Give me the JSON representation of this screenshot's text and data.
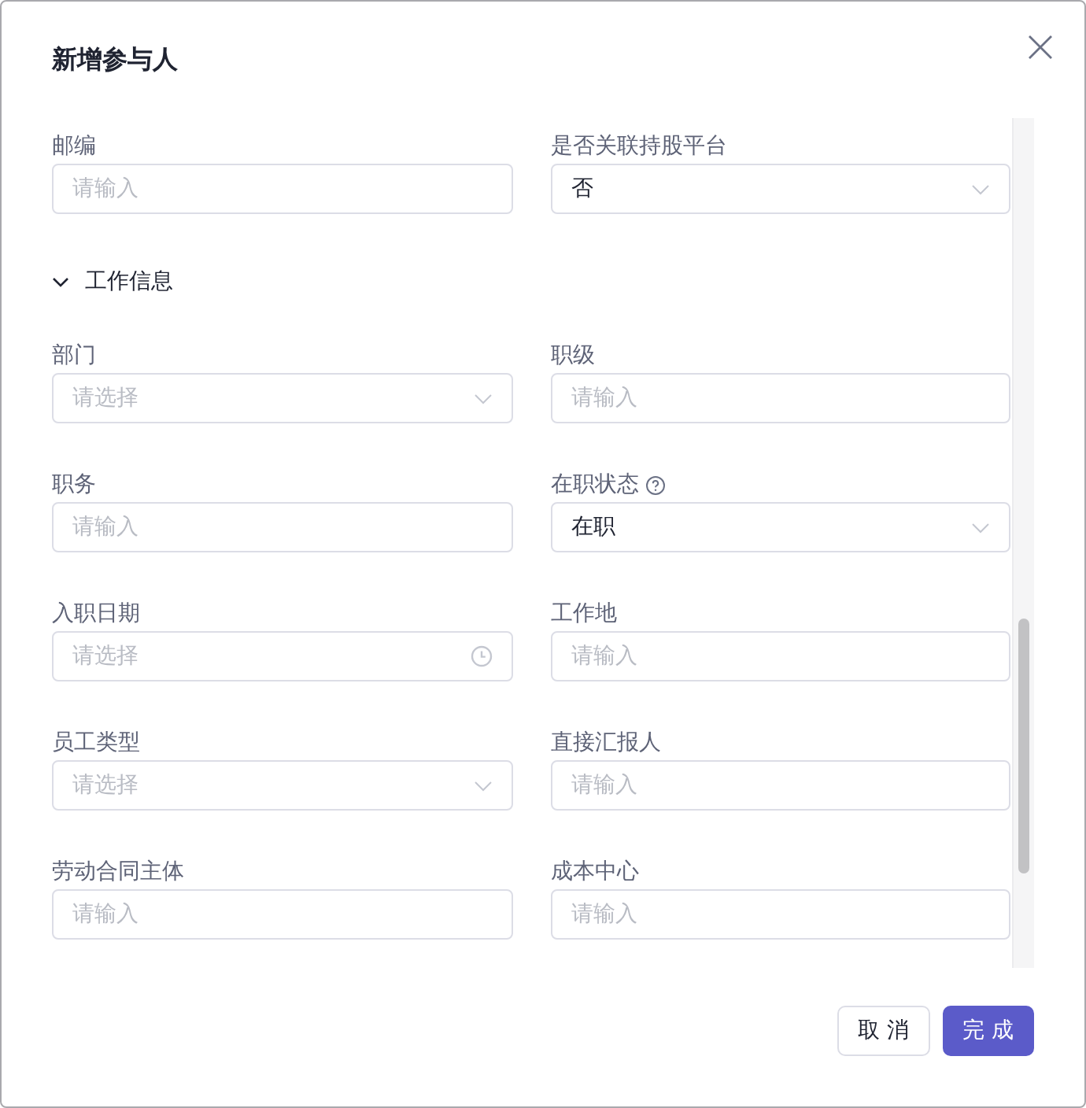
{
  "dialog": {
    "title": "新增参与人"
  },
  "sections": [
    {
      "fields": [
        {
          "label": "邮编",
          "kind": "input",
          "placeholder": "请输入"
        },
        {
          "label": "是否关联持股平台",
          "kind": "select",
          "value": "否"
        }
      ]
    },
    {
      "title": "工作信息",
      "expanded": true,
      "fields": [
        {
          "label": "部门",
          "kind": "select",
          "placeholder": "请选择"
        },
        {
          "label": "职级",
          "kind": "input",
          "placeholder": "请输入"
        },
        {
          "label": "职务",
          "kind": "input",
          "placeholder": "请输入"
        },
        {
          "label": "在职状态",
          "kind": "select",
          "value": "在职",
          "help": true
        },
        {
          "label": "入职日期",
          "kind": "date",
          "placeholder": "请选择"
        },
        {
          "label": "工作地",
          "kind": "input",
          "placeholder": "请输入"
        },
        {
          "label": "员工类型",
          "kind": "select",
          "placeholder": "请选择"
        },
        {
          "label": "直接汇报人",
          "kind": "input",
          "placeholder": "请输入"
        },
        {
          "label": "劳动合同主体",
          "kind": "input",
          "placeholder": "请输入"
        },
        {
          "label": "成本中心",
          "kind": "input",
          "placeholder": "请输入"
        }
      ]
    }
  ],
  "buttons": [
    {
      "label": "取 消",
      "kind": "secondary"
    },
    {
      "label": "完 成",
      "kind": "primary"
    }
  ]
}
